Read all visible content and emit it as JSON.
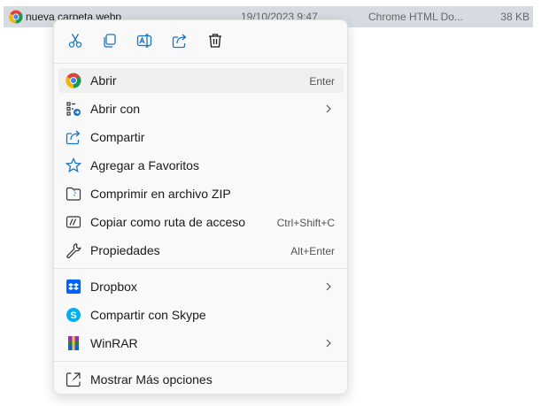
{
  "file": {
    "name": "nueva carpeta.webp",
    "date": "19/10/2023 9:47",
    "type": "Chrome HTML Do...",
    "size": "38 KB"
  },
  "toolbar": {
    "icons": [
      "cut-icon",
      "copy-icon",
      "rename-icon",
      "share-icon",
      "delete-icon"
    ]
  },
  "menu": {
    "items": [
      {
        "label": "Abrir",
        "shortcut": "Enter",
        "icon": "chrome-icon"
      },
      {
        "label": "Abrir con",
        "shortcut": "",
        "icon": "open-with-icon",
        "submenu": true
      },
      {
        "label": "Compartir",
        "shortcut": "",
        "icon": "share-icon"
      },
      {
        "label": "Agregar a Favoritos",
        "shortcut": "",
        "icon": "star-icon"
      },
      {
        "label": "Comprimir en archivo ZIP",
        "shortcut": "",
        "icon": "zip-icon"
      },
      {
        "label": "Copiar como ruta de acceso",
        "shortcut": "Ctrl+Shift+C",
        "icon": "path-icon"
      },
      {
        "label": "Propiedades",
        "shortcut": "Alt+Enter",
        "icon": "wrench-icon"
      },
      {
        "label": "Dropbox",
        "shortcut": "",
        "icon": "dropbox-icon",
        "submenu": true
      },
      {
        "label": "Compartir con Skype",
        "shortcut": "",
        "icon": "skype-icon"
      },
      {
        "label": "WinRAR",
        "shortcut": "",
        "icon": "winrar-icon",
        "submenu": true
      },
      {
        "label": "Mostrar Más opciones",
        "shortcut": "",
        "icon": "more-options-icon"
      }
    ]
  },
  "colors": {
    "accent": "#1a73c4",
    "selection": "#d6dbe2",
    "menu_bg": "#f9f9f9"
  }
}
